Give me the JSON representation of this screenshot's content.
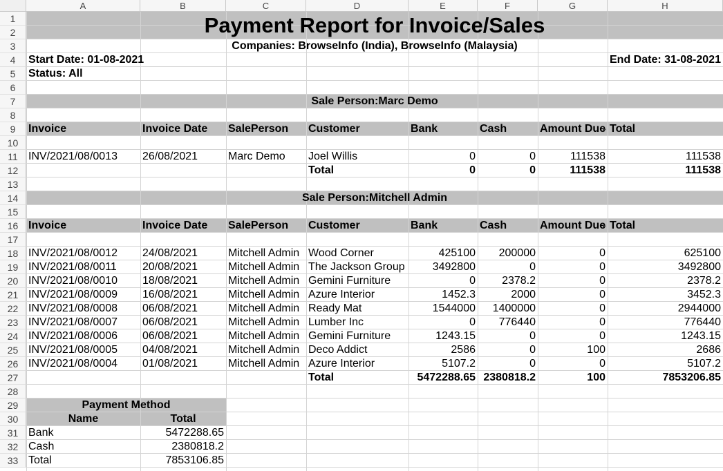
{
  "columns": [
    "A",
    "B",
    "C",
    "D",
    "E",
    "F",
    "G",
    "H"
  ],
  "row_numbers": [
    "1",
    "2",
    "3",
    "4",
    "5",
    "6",
    "7",
    "8",
    "9",
    "10",
    "11",
    "12",
    "13",
    "14",
    "15",
    "16",
    "17",
    "18",
    "19",
    "20",
    "21",
    "22",
    "23",
    "24",
    "25",
    "26",
    "27",
    "28",
    "29",
    "30",
    "31",
    "32",
    "33"
  ],
  "report": {
    "title": "Payment Report for Invoice/Sales",
    "companies": "Companies: BrowseInfo (India), BrowseInfo (Malaysia)",
    "start_date": "Start Date: 01-08-2021",
    "end_date": "End Date: 31-08-2021",
    "status": "Status: All"
  },
  "headers": [
    "Invoice",
    "Invoice Date",
    "SalePerson",
    "Customer",
    "Bank",
    "Cash",
    "Amount Due",
    "Total"
  ],
  "sections": [
    {
      "sale_person": "Sale Person:Marc Demo",
      "rows": [
        [
          "INV/2021/08/0013",
          "26/08/2021",
          "Marc Demo",
          "Joel Willis",
          "0",
          "0",
          "111538",
          "111538"
        ]
      ],
      "total": [
        "Total",
        "0",
        "0",
        "111538",
        "111538"
      ]
    },
    {
      "sale_person": "Sale Person:Mitchell Admin",
      "rows": [
        [
          "INV/2021/08/0012",
          "24/08/2021",
          "Mitchell Admin",
          "Wood Corner",
          "425100",
          "200000",
          "0",
          "625100"
        ],
        [
          "INV/2021/08/0011",
          "20/08/2021",
          "Mitchell Admin",
          "The Jackson Group",
          "3492800",
          "0",
          "0",
          "3492800"
        ],
        [
          "INV/2021/08/0010",
          "18/08/2021",
          "Mitchell Admin",
          "Gemini Furniture",
          "0",
          "2378.2",
          "0",
          "2378.2"
        ],
        [
          "INV/2021/08/0009",
          "16/08/2021",
          "Mitchell Admin",
          "Azure Interior",
          "1452.3",
          "2000",
          "0",
          "3452.3"
        ],
        [
          "INV/2021/08/0008",
          "06/08/2021",
          "Mitchell Admin",
          "Ready Mat",
          "1544000",
          "1400000",
          "0",
          "2944000"
        ],
        [
          "INV/2021/08/0007",
          "06/08/2021",
          "Mitchell Admin",
          "Lumber Inc",
          "0",
          "776440",
          "0",
          "776440"
        ],
        [
          "INV/2021/08/0006",
          "06/08/2021",
          "Mitchell Admin",
          "Gemini Furniture",
          "1243.15",
          "0",
          "0",
          "1243.15"
        ],
        [
          "INV/2021/08/0005",
          "04/08/2021",
          "Mitchell Admin",
          "Deco Addict",
          "2586",
          "0",
          "100",
          "2686"
        ],
        [
          "INV/2021/08/0004",
          "01/08/2021",
          "Mitchell Admin",
          "Azure Interior",
          "5107.2",
          "0",
          "0",
          "5107.2"
        ]
      ],
      "total": [
        "Total",
        "5472288.65",
        "2380818.2",
        "100",
        "7853206.85"
      ]
    }
  ],
  "payment_method": {
    "title": "Payment Method",
    "name_header": "Name",
    "total_header": "Total",
    "rows": [
      [
        "Bank",
        "5472288.65"
      ],
      [
        "Cash",
        "2380818.2"
      ],
      [
        "Total",
        "7853106.85"
      ]
    ]
  },
  "colors": {
    "band": "#c0c0c0",
    "grid": "#d4d4d4",
    "header_bg": "#f6f6f6"
  }
}
